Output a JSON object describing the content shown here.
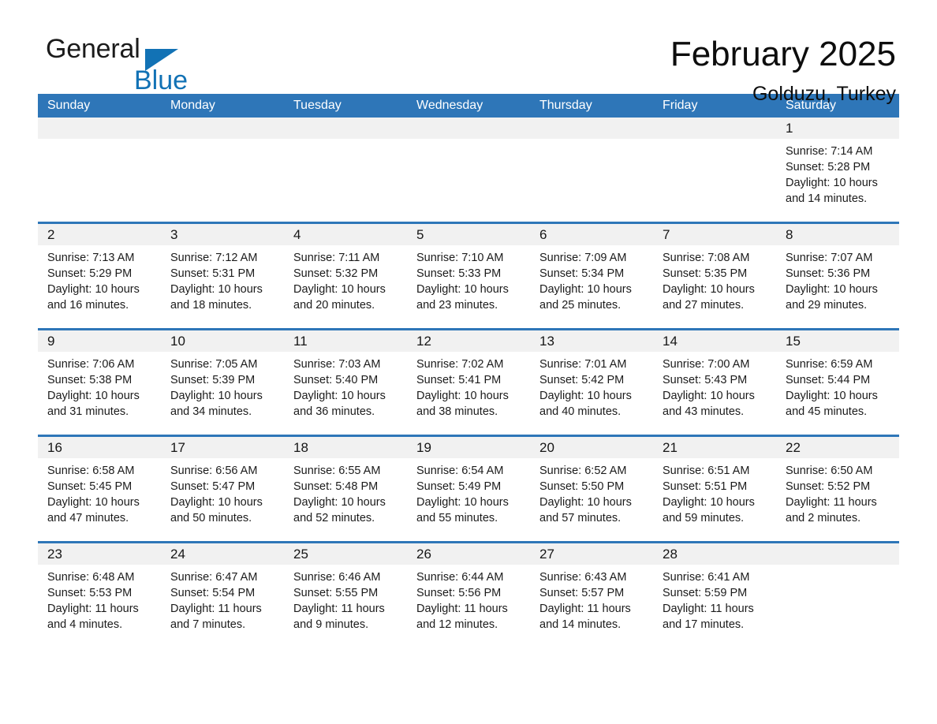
{
  "brand": {
    "word1": "General",
    "word2": "Blue",
    "triangle_color": "#1272b5",
    "icon": "triangle-logo-icon"
  },
  "header": {
    "title": "February 2025",
    "subtitle": "Golduzu, Turkey"
  },
  "theme": {
    "accent": "#2e76b8",
    "header_text": "#ffffff",
    "daynum_band": "#f1f1f1",
    "body_text": "#1b1b1b"
  },
  "weekdays": [
    "Sunday",
    "Monday",
    "Tuesday",
    "Wednesday",
    "Thursday",
    "Friday",
    "Saturday"
  ],
  "weeks": [
    [
      {
        "day": "",
        "lines": [
          "",
          "",
          "",
          ""
        ]
      },
      {
        "day": "",
        "lines": [
          "",
          "",
          "",
          ""
        ]
      },
      {
        "day": "",
        "lines": [
          "",
          "",
          "",
          ""
        ]
      },
      {
        "day": "",
        "lines": [
          "",
          "",
          "",
          ""
        ]
      },
      {
        "day": "",
        "lines": [
          "",
          "",
          "",
          ""
        ]
      },
      {
        "day": "",
        "lines": [
          "",
          "",
          "",
          ""
        ]
      },
      {
        "day": "1",
        "lines": [
          "Sunrise: 7:14 AM",
          "Sunset: 5:28 PM",
          "Daylight: 10 hours",
          "and 14 minutes."
        ]
      }
    ],
    [
      {
        "day": "2",
        "lines": [
          "Sunrise: 7:13 AM",
          "Sunset: 5:29 PM",
          "Daylight: 10 hours",
          "and 16 minutes."
        ]
      },
      {
        "day": "3",
        "lines": [
          "Sunrise: 7:12 AM",
          "Sunset: 5:31 PM",
          "Daylight: 10 hours",
          "and 18 minutes."
        ]
      },
      {
        "day": "4",
        "lines": [
          "Sunrise: 7:11 AM",
          "Sunset: 5:32 PM",
          "Daylight: 10 hours",
          "and 20 minutes."
        ]
      },
      {
        "day": "5",
        "lines": [
          "Sunrise: 7:10 AM",
          "Sunset: 5:33 PM",
          "Daylight: 10 hours",
          "and 23 minutes."
        ]
      },
      {
        "day": "6",
        "lines": [
          "Sunrise: 7:09 AM",
          "Sunset: 5:34 PM",
          "Daylight: 10 hours",
          "and 25 minutes."
        ]
      },
      {
        "day": "7",
        "lines": [
          "Sunrise: 7:08 AM",
          "Sunset: 5:35 PM",
          "Daylight: 10 hours",
          "and 27 minutes."
        ]
      },
      {
        "day": "8",
        "lines": [
          "Sunrise: 7:07 AM",
          "Sunset: 5:36 PM",
          "Daylight: 10 hours",
          "and 29 minutes."
        ]
      }
    ],
    [
      {
        "day": "9",
        "lines": [
          "Sunrise: 7:06 AM",
          "Sunset: 5:38 PM",
          "Daylight: 10 hours",
          "and 31 minutes."
        ]
      },
      {
        "day": "10",
        "lines": [
          "Sunrise: 7:05 AM",
          "Sunset: 5:39 PM",
          "Daylight: 10 hours",
          "and 34 minutes."
        ]
      },
      {
        "day": "11",
        "lines": [
          "Sunrise: 7:03 AM",
          "Sunset: 5:40 PM",
          "Daylight: 10 hours",
          "and 36 minutes."
        ]
      },
      {
        "day": "12",
        "lines": [
          "Sunrise: 7:02 AM",
          "Sunset: 5:41 PM",
          "Daylight: 10 hours",
          "and 38 minutes."
        ]
      },
      {
        "day": "13",
        "lines": [
          "Sunrise: 7:01 AM",
          "Sunset: 5:42 PM",
          "Daylight: 10 hours",
          "and 40 minutes."
        ]
      },
      {
        "day": "14",
        "lines": [
          "Sunrise: 7:00 AM",
          "Sunset: 5:43 PM",
          "Daylight: 10 hours",
          "and 43 minutes."
        ]
      },
      {
        "day": "15",
        "lines": [
          "Sunrise: 6:59 AM",
          "Sunset: 5:44 PM",
          "Daylight: 10 hours",
          "and 45 minutes."
        ]
      }
    ],
    [
      {
        "day": "16",
        "lines": [
          "Sunrise: 6:58 AM",
          "Sunset: 5:45 PM",
          "Daylight: 10 hours",
          "and 47 minutes."
        ]
      },
      {
        "day": "17",
        "lines": [
          "Sunrise: 6:56 AM",
          "Sunset: 5:47 PM",
          "Daylight: 10 hours",
          "and 50 minutes."
        ]
      },
      {
        "day": "18",
        "lines": [
          "Sunrise: 6:55 AM",
          "Sunset: 5:48 PM",
          "Daylight: 10 hours",
          "and 52 minutes."
        ]
      },
      {
        "day": "19",
        "lines": [
          "Sunrise: 6:54 AM",
          "Sunset: 5:49 PM",
          "Daylight: 10 hours",
          "and 55 minutes."
        ]
      },
      {
        "day": "20",
        "lines": [
          "Sunrise: 6:52 AM",
          "Sunset: 5:50 PM",
          "Daylight: 10 hours",
          "and 57 minutes."
        ]
      },
      {
        "day": "21",
        "lines": [
          "Sunrise: 6:51 AM",
          "Sunset: 5:51 PM",
          "Daylight: 10 hours",
          "and 59 minutes."
        ]
      },
      {
        "day": "22",
        "lines": [
          "Sunrise: 6:50 AM",
          "Sunset: 5:52 PM",
          "Daylight: 11 hours",
          "and 2 minutes."
        ]
      }
    ],
    [
      {
        "day": "23",
        "lines": [
          "Sunrise: 6:48 AM",
          "Sunset: 5:53 PM",
          "Daylight: 11 hours",
          "and 4 minutes."
        ]
      },
      {
        "day": "24",
        "lines": [
          "Sunrise: 6:47 AM",
          "Sunset: 5:54 PM",
          "Daylight: 11 hours",
          "and 7 minutes."
        ]
      },
      {
        "day": "25",
        "lines": [
          "Sunrise: 6:46 AM",
          "Sunset: 5:55 PM",
          "Daylight: 11 hours",
          "and 9 minutes."
        ]
      },
      {
        "day": "26",
        "lines": [
          "Sunrise: 6:44 AM",
          "Sunset: 5:56 PM",
          "Daylight: 11 hours",
          "and 12 minutes."
        ]
      },
      {
        "day": "27",
        "lines": [
          "Sunrise: 6:43 AM",
          "Sunset: 5:57 PM",
          "Daylight: 11 hours",
          "and 14 minutes."
        ]
      },
      {
        "day": "28",
        "lines": [
          "Sunrise: 6:41 AM",
          "Sunset: 5:59 PM",
          "Daylight: 11 hours",
          "and 17 minutes."
        ]
      },
      {
        "day": "",
        "lines": [
          "",
          "",
          "",
          ""
        ]
      }
    ]
  ]
}
